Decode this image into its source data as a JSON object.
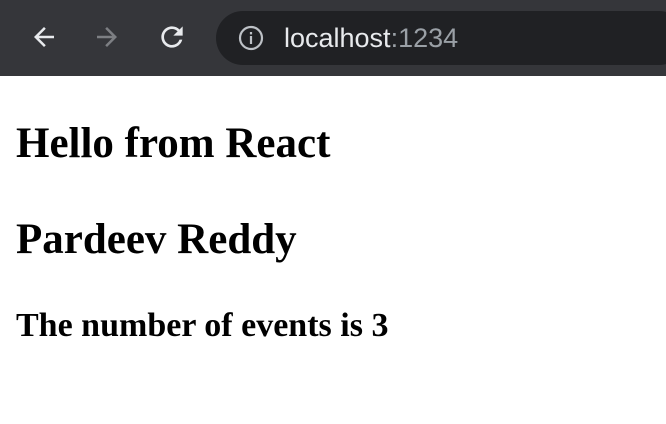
{
  "browser": {
    "address_bar": {
      "host": "localhost",
      "port": ":1234"
    },
    "icons": {
      "back": "back-arrow-icon",
      "forward": "forward-arrow-icon",
      "reload": "reload-icon",
      "site_info": "info-icon"
    },
    "colors": {
      "toolbar_bg": "#35363a",
      "omnibox_bg": "#202124",
      "url_text": "#e8eaed",
      "url_port": "#9aa0a6"
    }
  },
  "page": {
    "heading_1": "Hello from React",
    "heading_2": "Pardeev Reddy",
    "subheading": "The number of events is 3"
  }
}
